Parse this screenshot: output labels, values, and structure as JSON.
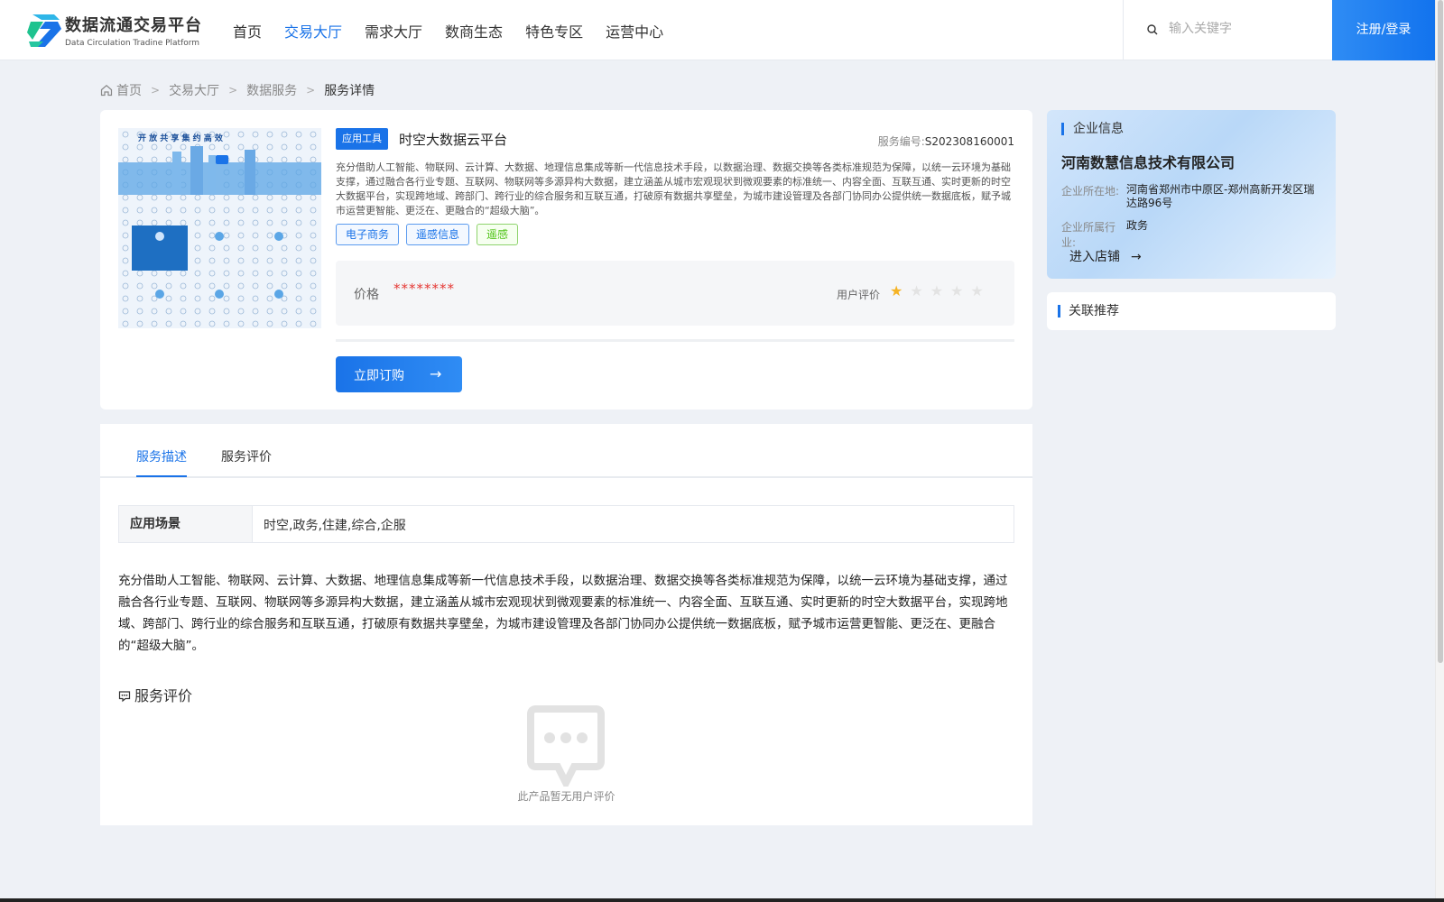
{
  "header": {
    "logo_title": "数据流通交易平台",
    "logo_subtitle": "Data Circulation Tradine Platform",
    "nav": [
      {
        "label": "首页",
        "active": false
      },
      {
        "label": "交易大厅",
        "active": true
      },
      {
        "label": "需求大厅",
        "active": false
      },
      {
        "label": "数商生态",
        "active": false
      },
      {
        "label": "特色专区",
        "active": false
      },
      {
        "label": "运营中心",
        "active": false
      }
    ],
    "search_placeholder": "输入关键字",
    "login_label": "注册/登录"
  },
  "breadcrumb": [
    "首页",
    "交易大厅",
    "数据服务",
    "服务详情"
  ],
  "product": {
    "badge": "应用工具",
    "title": "时空大数据云平台",
    "service_no_label": "服务编号:",
    "service_no": "S202308160001",
    "description": "充分借助人工智能、物联网、云计算、大数据、地理信息集成等新一代信息技术手段，以数据治理、数据交换等各类标准规范为保障，以统一云环境为基础支撑，通过融合各行业专题、互联网、物联网等多源异构大数据，建立涵盖从城市宏观现状到微观要素的标准统一、内容全面、互联互通、实时更新的时空大数据平台，实现跨地域、跨部门、跨行业的综合服务和互联互通，打破原有数据共享壁垒，为城市建设管理及各部门协同办公提供统一数据底板，赋予城市运营更智能、更泛在、更融合的“超级大脑”。",
    "tags": [
      {
        "label": "电子商务",
        "color": "blue"
      },
      {
        "label": "遥感信息",
        "color": "blue"
      },
      {
        "label": "遥感",
        "color": "green"
      }
    ],
    "price_label": "价格",
    "price_value": "********",
    "rating_label": "用户评价",
    "rating": 1,
    "rating_max": 5,
    "order_label": "立即订购",
    "thumbnail_caption": "开 放 共 享  集 约 高 效"
  },
  "detail": {
    "tabs": [
      {
        "label": "服务描述",
        "active": true
      },
      {
        "label": "服务评价",
        "active": false
      }
    ],
    "scene_label": "应用场景",
    "scene_value": "时空,政务,住建,综合,企服",
    "long_description": "充分借助人工智能、物联网、云计算、大数据、地理信息集成等新一代信息技术手段，以数据治理、数据交换等各类标准规范为保障，以统一云环境为基础支撑，通过融合各行业专题、互联网、物联网等多源异构大数据，建立涵盖从城市宏观现状到微观要素的标准统一、内容全面、互联互通、实时更新的时空大数据平台，实现跨地域、跨部门、跨行业的综合服务和互联互通，打破原有数据共享壁垒，为城市建设管理及各部门协同办公提供统一数据底板，赋予城市运营更智能、更泛在、更融合的“超级大脑”。",
    "eval_title": "服务评价",
    "empty_text": "此产品暂无用户评价"
  },
  "company": {
    "heading": "企业信息",
    "name": "河南数慧信息技术有限公司",
    "location_label": "企业所在地:",
    "location": "河南省郑州市中原区-郑州高新开发区瑞达路96号",
    "industry_label": "企业所属行业:",
    "industry": "政务",
    "enter_label": "进入店铺"
  },
  "related": {
    "heading": "关联推荐"
  },
  "colors": {
    "accent": "#1a73e8",
    "price": "#e53935",
    "star_on": "#f5b324",
    "star_off": "#e3e3e3"
  }
}
